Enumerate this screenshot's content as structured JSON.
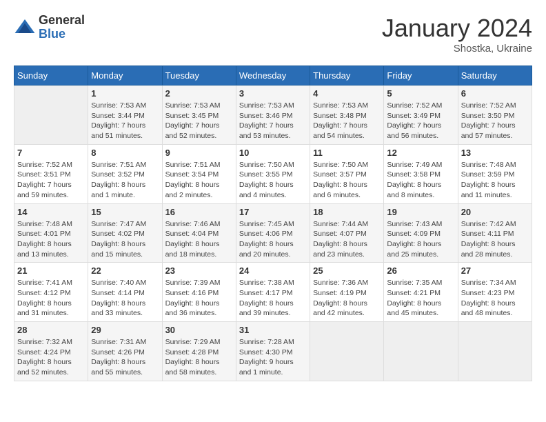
{
  "header": {
    "logo_line1": "General",
    "logo_line2": "Blue",
    "month_title": "January 2024",
    "location": "Shostka, Ukraine"
  },
  "days_of_week": [
    "Sunday",
    "Monday",
    "Tuesday",
    "Wednesday",
    "Thursday",
    "Friday",
    "Saturday"
  ],
  "weeks": [
    [
      {
        "day": "",
        "info": ""
      },
      {
        "day": "1",
        "info": "Sunrise: 7:53 AM\nSunset: 3:44 PM\nDaylight: 7 hours\nand 51 minutes."
      },
      {
        "day": "2",
        "info": "Sunrise: 7:53 AM\nSunset: 3:45 PM\nDaylight: 7 hours\nand 52 minutes."
      },
      {
        "day": "3",
        "info": "Sunrise: 7:53 AM\nSunset: 3:46 PM\nDaylight: 7 hours\nand 53 minutes."
      },
      {
        "day": "4",
        "info": "Sunrise: 7:53 AM\nSunset: 3:48 PM\nDaylight: 7 hours\nand 54 minutes."
      },
      {
        "day": "5",
        "info": "Sunrise: 7:52 AM\nSunset: 3:49 PM\nDaylight: 7 hours\nand 56 minutes."
      },
      {
        "day": "6",
        "info": "Sunrise: 7:52 AM\nSunset: 3:50 PM\nDaylight: 7 hours\nand 57 minutes."
      }
    ],
    [
      {
        "day": "7",
        "info": "Sunrise: 7:52 AM\nSunset: 3:51 PM\nDaylight: 7 hours\nand 59 minutes."
      },
      {
        "day": "8",
        "info": "Sunrise: 7:51 AM\nSunset: 3:52 PM\nDaylight: 8 hours\nand 1 minute."
      },
      {
        "day": "9",
        "info": "Sunrise: 7:51 AM\nSunset: 3:54 PM\nDaylight: 8 hours\nand 2 minutes."
      },
      {
        "day": "10",
        "info": "Sunrise: 7:50 AM\nSunset: 3:55 PM\nDaylight: 8 hours\nand 4 minutes."
      },
      {
        "day": "11",
        "info": "Sunrise: 7:50 AM\nSunset: 3:57 PM\nDaylight: 8 hours\nand 6 minutes."
      },
      {
        "day": "12",
        "info": "Sunrise: 7:49 AM\nSunset: 3:58 PM\nDaylight: 8 hours\nand 8 minutes."
      },
      {
        "day": "13",
        "info": "Sunrise: 7:48 AM\nSunset: 3:59 PM\nDaylight: 8 hours\nand 11 minutes."
      }
    ],
    [
      {
        "day": "14",
        "info": "Sunrise: 7:48 AM\nSunset: 4:01 PM\nDaylight: 8 hours\nand 13 minutes."
      },
      {
        "day": "15",
        "info": "Sunrise: 7:47 AM\nSunset: 4:02 PM\nDaylight: 8 hours\nand 15 minutes."
      },
      {
        "day": "16",
        "info": "Sunrise: 7:46 AM\nSunset: 4:04 PM\nDaylight: 8 hours\nand 18 minutes."
      },
      {
        "day": "17",
        "info": "Sunrise: 7:45 AM\nSunset: 4:06 PM\nDaylight: 8 hours\nand 20 minutes."
      },
      {
        "day": "18",
        "info": "Sunrise: 7:44 AM\nSunset: 4:07 PM\nDaylight: 8 hours\nand 23 minutes."
      },
      {
        "day": "19",
        "info": "Sunrise: 7:43 AM\nSunset: 4:09 PM\nDaylight: 8 hours\nand 25 minutes."
      },
      {
        "day": "20",
        "info": "Sunrise: 7:42 AM\nSunset: 4:11 PM\nDaylight: 8 hours\nand 28 minutes."
      }
    ],
    [
      {
        "day": "21",
        "info": "Sunrise: 7:41 AM\nSunset: 4:12 PM\nDaylight: 8 hours\nand 31 minutes."
      },
      {
        "day": "22",
        "info": "Sunrise: 7:40 AM\nSunset: 4:14 PM\nDaylight: 8 hours\nand 33 minutes."
      },
      {
        "day": "23",
        "info": "Sunrise: 7:39 AM\nSunset: 4:16 PM\nDaylight: 8 hours\nand 36 minutes."
      },
      {
        "day": "24",
        "info": "Sunrise: 7:38 AM\nSunset: 4:17 PM\nDaylight: 8 hours\nand 39 minutes."
      },
      {
        "day": "25",
        "info": "Sunrise: 7:36 AM\nSunset: 4:19 PM\nDaylight: 8 hours\nand 42 minutes."
      },
      {
        "day": "26",
        "info": "Sunrise: 7:35 AM\nSunset: 4:21 PM\nDaylight: 8 hours\nand 45 minutes."
      },
      {
        "day": "27",
        "info": "Sunrise: 7:34 AM\nSunset: 4:23 PM\nDaylight: 8 hours\nand 48 minutes."
      }
    ],
    [
      {
        "day": "28",
        "info": "Sunrise: 7:32 AM\nSunset: 4:24 PM\nDaylight: 8 hours\nand 52 minutes."
      },
      {
        "day": "29",
        "info": "Sunrise: 7:31 AM\nSunset: 4:26 PM\nDaylight: 8 hours\nand 55 minutes."
      },
      {
        "day": "30",
        "info": "Sunrise: 7:29 AM\nSunset: 4:28 PM\nDaylight: 8 hours\nand 58 minutes."
      },
      {
        "day": "31",
        "info": "Sunrise: 7:28 AM\nSunset: 4:30 PM\nDaylight: 9 hours\nand 1 minute."
      },
      {
        "day": "",
        "info": ""
      },
      {
        "day": "",
        "info": ""
      },
      {
        "day": "",
        "info": ""
      }
    ]
  ]
}
